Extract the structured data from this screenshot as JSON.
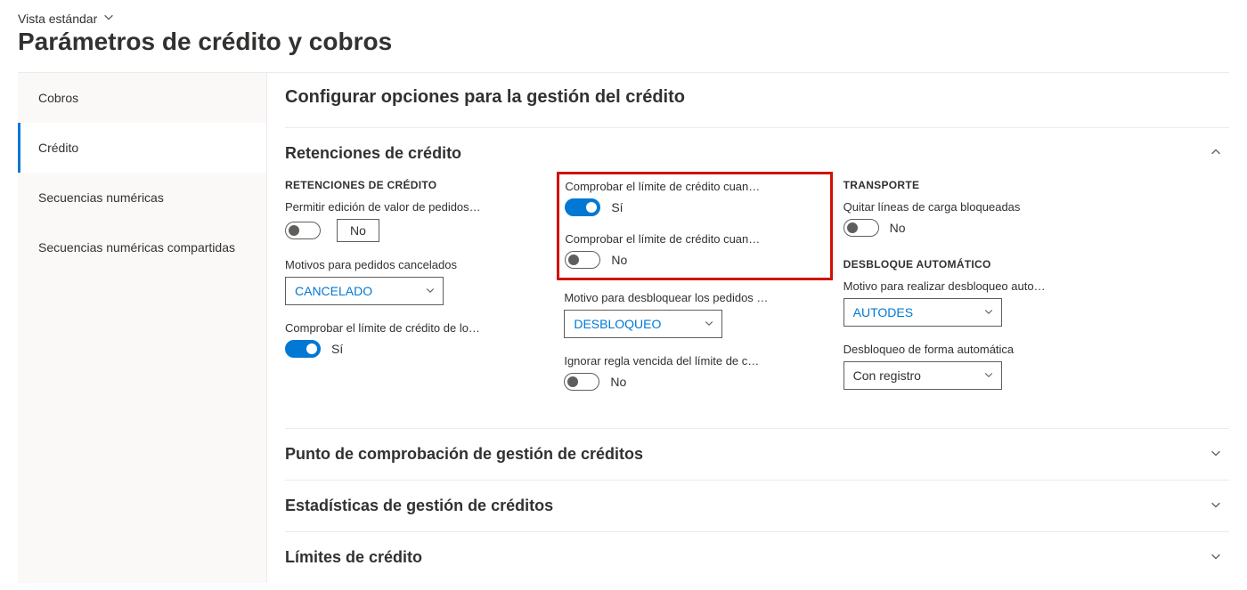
{
  "header": {
    "view_label": "Vista estándar",
    "page_title": "Parámetros de crédito y cobros"
  },
  "sidebar": {
    "items": [
      {
        "label": "Cobros"
      },
      {
        "label": "Crédito"
      },
      {
        "label": "Secuencias numéricas"
      },
      {
        "label": "Secuencias numéricas compartidas"
      }
    ],
    "active_index": 1
  },
  "main": {
    "title": "Configurar opciones para la gestión del crédito"
  },
  "section_retenciones": {
    "title": "Retenciones de crédito",
    "col1_heading": "RETENCIONES DE CRÉDITO",
    "allow_edit_label": "Permitir edición de valor de pedidos…",
    "allow_edit_value": "No",
    "cancel_reason_label": "Motivos para pedidos cancelados",
    "cancel_reason_value": "CANCELADO",
    "check_credit_los_label": "Comprobar el límite de crédito de lo…",
    "check_credit_los_value": "Sí",
    "check_credit_cuan1_label": "Comprobar el límite de crédito cuan…",
    "check_credit_cuan1_value": "Sí",
    "check_credit_cuan2_label": "Comprobar el límite de crédito cuan…",
    "check_credit_cuan2_value": "No",
    "unblock_reason_label": "Motivo para desbloquear los pedidos …",
    "unblock_reason_value": "DESBLOQUEO",
    "ignore_expired_label": "Ignorar regla vencida del límite de c…",
    "ignore_expired_value": "No",
    "col3_heading_transport": "TRANSPORTE",
    "remove_blocked_label": "Quitar líneas de carga bloqueadas",
    "remove_blocked_value": "No",
    "col3_heading_auto": "DESBLOQUE AUTOMÁTICO",
    "auto_unblock_reason_label": "Motivo para realizar desbloqueo auto…",
    "auto_unblock_reason_value": "AUTODES",
    "auto_unblock_mode_label": "Desbloqueo de forma automática",
    "auto_unblock_mode_value": "Con registro"
  },
  "sections_collapsed": [
    {
      "title": "Punto de comprobación de gestión de créditos"
    },
    {
      "title": "Estadísticas de gestión de créditos"
    },
    {
      "title": "Límites de crédito"
    }
  ]
}
